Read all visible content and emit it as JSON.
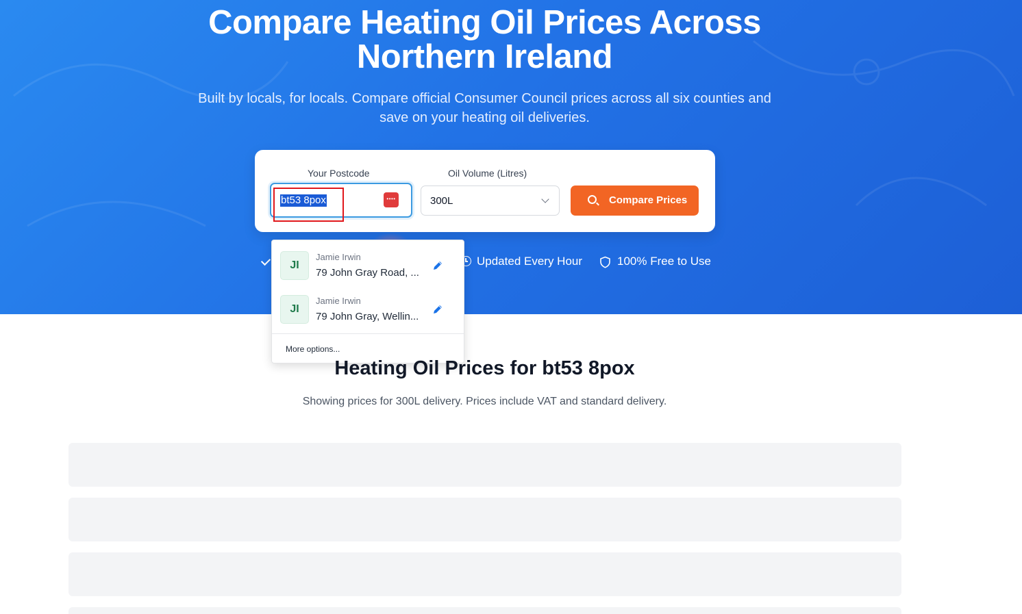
{
  "hero": {
    "title_line1": "Compare Heating Oil Prices Across",
    "title_line2": "Northern Ireland",
    "subtitle_line1": "Built by locals, for locals. Compare official Consumer Council prices across all six counties and",
    "subtitle_line2": "save on your heating oil deliveries."
  },
  "search": {
    "postcode_label": "Your Postcode",
    "postcode_value": "bt53 8pox",
    "volume_label": "Oil Volume (Litres)",
    "volume_value": "300L",
    "compare_label": "Compare Prices"
  },
  "features": {
    "updated": "Updated Every Hour",
    "free": "100% Free to Use"
  },
  "autofill": {
    "items": [
      {
        "initials": "JI",
        "name": "Jamie Irwin",
        "address": "79 John Gray Road, ..."
      },
      {
        "initials": "JI",
        "name": "Jamie Irwin",
        "address": "79 John Gray, Wellin..."
      }
    ],
    "more": "More options..."
  },
  "results": {
    "title": "Heating Oil Prices for bt53 8pox",
    "subtitle": "Showing prices for 300L delivery. Prices include VAT and standard delivery."
  },
  "colors": {
    "accent": "#f26524",
    "hero_blue": "#2272e6",
    "highlight": "#e0161b"
  }
}
